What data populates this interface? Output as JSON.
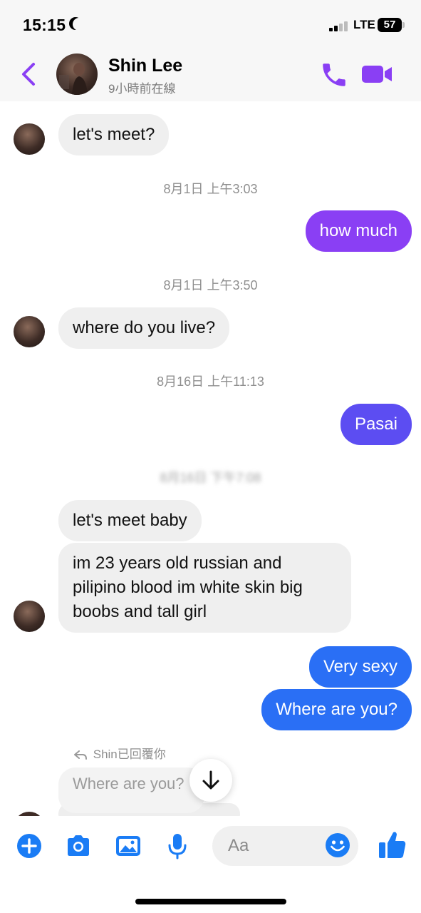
{
  "status_bar": {
    "time": "15:15",
    "network": "LTE",
    "battery": "57"
  },
  "header": {
    "name": "Shin Lee",
    "status": "9小時前在線"
  },
  "messages": [
    {
      "type": "received",
      "text": "let's meet?"
    },
    {
      "type": "timestamp",
      "text": "8月1日 上午3:03"
    },
    {
      "type": "sent",
      "text": "how much"
    },
    {
      "type": "timestamp",
      "text": "8月1日 上午3:50"
    },
    {
      "type": "received",
      "text": "where do you live?"
    },
    {
      "type": "timestamp",
      "text": "8月16日 上午11:13"
    },
    {
      "type": "sent",
      "text": "Pasai"
    },
    {
      "type": "timestamp",
      "text": "8月16日 下午7:08"
    },
    {
      "type": "received",
      "text": "let's meet baby"
    },
    {
      "type": "received",
      "lines": [
        "im 23 years old russian and",
        "pilipino blood im white skin big",
        "boobs and tall girl"
      ]
    },
    {
      "type": "sent",
      "text": "Very sexy"
    },
    {
      "type": "sent",
      "text": "Where are you?"
    }
  ],
  "reply": {
    "label": "Shin已回覆你",
    "quoted": "Where are you?"
  },
  "composer": {
    "placeholder": "Aa"
  },
  "colors": {
    "accent_purple": "#8a3ff4",
    "accent_indigo": "#5c4df2",
    "accent_blue": "#2a6ff5",
    "composer_blue": "#1a7cf5"
  },
  "icons": [
    "back-chevron-icon",
    "phone-icon",
    "video-icon",
    "plus-icon",
    "camera-icon",
    "gallery-icon",
    "microphone-icon",
    "emoji-icon",
    "thumbs-up-icon",
    "arrow-down-icon",
    "reply-arrow-icon",
    "moon-icon"
  ]
}
